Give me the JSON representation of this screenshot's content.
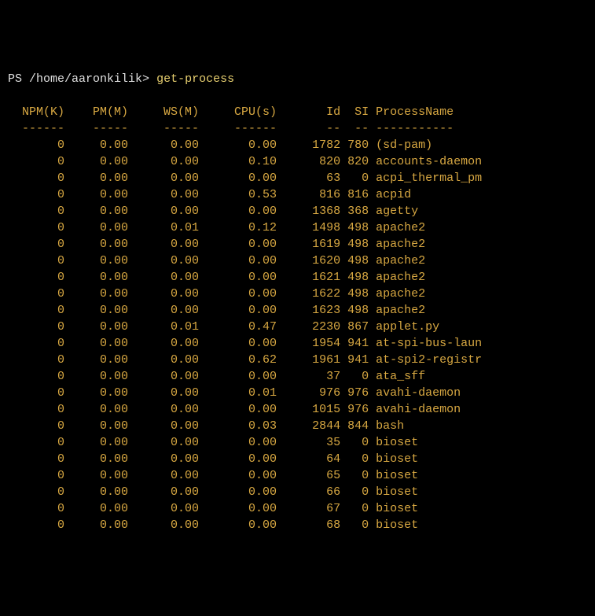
{
  "prompt": {
    "ps": "PS",
    "path": "/home/aaronkilik",
    "gt": ">",
    "command": "get-process"
  },
  "columns": {
    "npm": {
      "label": "NPM(K)",
      "sep": "------"
    },
    "pm": {
      "label": "PM(M)",
      "sep": "-----"
    },
    "ws": {
      "label": "WS(M)",
      "sep": "-----"
    },
    "cpu": {
      "label": "CPU(s)",
      "sep": "------"
    },
    "id": {
      "label": "Id",
      "sep": "--"
    },
    "si": {
      "label": "SI",
      "sep": "--"
    },
    "name": {
      "label": "ProcessName",
      "sep": "-----------"
    }
  },
  "rows": [
    {
      "npm": "0",
      "pm": "0.00",
      "ws": "0.00",
      "cpu": "0.00",
      "id": "1782",
      "si": "780",
      "name": "(sd-pam)"
    },
    {
      "npm": "0",
      "pm": "0.00",
      "ws": "0.00",
      "cpu": "0.10",
      "id": "820",
      "si": "820",
      "name": "accounts-daemon"
    },
    {
      "npm": "0",
      "pm": "0.00",
      "ws": "0.00",
      "cpu": "0.00",
      "id": "63",
      "si": "0",
      "name": "acpi_thermal_pm"
    },
    {
      "npm": "0",
      "pm": "0.00",
      "ws": "0.00",
      "cpu": "0.53",
      "id": "816",
      "si": "816",
      "name": "acpid"
    },
    {
      "npm": "0",
      "pm": "0.00",
      "ws": "0.00",
      "cpu": "0.00",
      "id": "1368",
      "si": "368",
      "name": "agetty"
    },
    {
      "npm": "0",
      "pm": "0.00",
      "ws": "0.01",
      "cpu": "0.12",
      "id": "1498",
      "si": "498",
      "name": "apache2"
    },
    {
      "npm": "0",
      "pm": "0.00",
      "ws": "0.00",
      "cpu": "0.00",
      "id": "1619",
      "si": "498",
      "name": "apache2"
    },
    {
      "npm": "0",
      "pm": "0.00",
      "ws": "0.00",
      "cpu": "0.00",
      "id": "1620",
      "si": "498",
      "name": "apache2"
    },
    {
      "npm": "0",
      "pm": "0.00",
      "ws": "0.00",
      "cpu": "0.00",
      "id": "1621",
      "si": "498",
      "name": "apache2"
    },
    {
      "npm": "0",
      "pm": "0.00",
      "ws": "0.00",
      "cpu": "0.00",
      "id": "1622",
      "si": "498",
      "name": "apache2"
    },
    {
      "npm": "0",
      "pm": "0.00",
      "ws": "0.00",
      "cpu": "0.00",
      "id": "1623",
      "si": "498",
      "name": "apache2"
    },
    {
      "npm": "0",
      "pm": "0.00",
      "ws": "0.01",
      "cpu": "0.47",
      "id": "2230",
      "si": "867",
      "name": "applet.py"
    },
    {
      "npm": "0",
      "pm": "0.00",
      "ws": "0.00",
      "cpu": "0.00",
      "id": "1954",
      "si": "941",
      "name": "at-spi-bus-laun"
    },
    {
      "npm": "0",
      "pm": "0.00",
      "ws": "0.00",
      "cpu": "0.62",
      "id": "1961",
      "si": "941",
      "name": "at-spi2-registr"
    },
    {
      "npm": "0",
      "pm": "0.00",
      "ws": "0.00",
      "cpu": "0.00",
      "id": "37",
      "si": "0",
      "name": "ata_sff"
    },
    {
      "npm": "0",
      "pm": "0.00",
      "ws": "0.00",
      "cpu": "0.01",
      "id": "976",
      "si": "976",
      "name": "avahi-daemon"
    },
    {
      "npm": "0",
      "pm": "0.00",
      "ws": "0.00",
      "cpu": "0.00",
      "id": "1015",
      "si": "976",
      "name": "avahi-daemon"
    },
    {
      "npm": "0",
      "pm": "0.00",
      "ws": "0.00",
      "cpu": "0.03",
      "id": "2844",
      "si": "844",
      "name": "bash"
    },
    {
      "npm": "0",
      "pm": "0.00",
      "ws": "0.00",
      "cpu": "0.00",
      "id": "35",
      "si": "0",
      "name": "bioset"
    },
    {
      "npm": "0",
      "pm": "0.00",
      "ws": "0.00",
      "cpu": "0.00",
      "id": "64",
      "si": "0",
      "name": "bioset"
    },
    {
      "npm": "0",
      "pm": "0.00",
      "ws": "0.00",
      "cpu": "0.00",
      "id": "65",
      "si": "0",
      "name": "bioset"
    },
    {
      "npm": "0",
      "pm": "0.00",
      "ws": "0.00",
      "cpu": "0.00",
      "id": "66",
      "si": "0",
      "name": "bioset"
    },
    {
      "npm": "0",
      "pm": "0.00",
      "ws": "0.00",
      "cpu": "0.00",
      "id": "67",
      "si": "0",
      "name": "bioset"
    },
    {
      "npm": "0",
      "pm": "0.00",
      "ws": "0.00",
      "cpu": "0.00",
      "id": "68",
      "si": "0",
      "name": "bioset"
    }
  ]
}
